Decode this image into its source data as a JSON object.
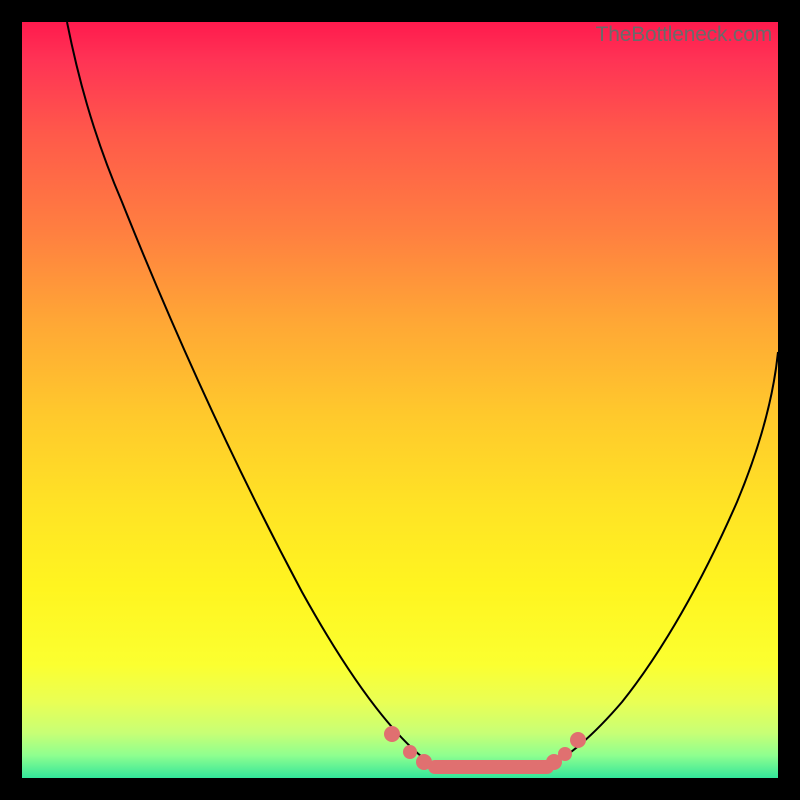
{
  "attribution": "TheBottleneck.com",
  "chart_data": {
    "type": "line",
    "title": "",
    "xlabel": "",
    "ylabel": "",
    "x_range": [
      0,
      100
    ],
    "y_range": [
      0,
      100
    ],
    "series": [
      {
        "name": "bottleneck-curve-left",
        "x": [
          6,
          10,
          15,
          20,
          25,
          30,
          35,
          40,
          45,
          48,
          50,
          52,
          54
        ],
        "y": [
          100,
          90,
          79,
          68,
          56,
          45,
          34,
          22,
          12,
          6,
          3,
          1.5,
          1
        ]
      },
      {
        "name": "bottleneck-curve-right",
        "x": [
          70,
          72,
          74,
          77,
          80,
          83,
          86,
          89,
          92,
          95,
          98,
          100
        ],
        "y": [
          1,
          1.5,
          2.5,
          4.5,
          7.5,
          12,
          18,
          25,
          33,
          42,
          52,
          60
        ]
      },
      {
        "name": "optimal-flat-region",
        "x": [
          54,
          56,
          58,
          60,
          62,
          64,
          66,
          68,
          70
        ],
        "y": [
          1,
          1,
          1,
          1,
          1,
          1,
          1,
          1,
          1
        ]
      }
    ],
    "markers": {
      "name": "optimal-points",
      "color": "#e07070",
      "points": [
        {
          "x": 48,
          "y": 5
        },
        {
          "x": 50,
          "y": 3
        },
        {
          "x": 52,
          "y": 1.8
        },
        {
          "x": 70,
          "y": 1.5
        },
        {
          "x": 71,
          "y": 2
        },
        {
          "x": 73,
          "y": 3.5
        }
      ]
    },
    "background_gradient": {
      "top": "#ff1a4d",
      "upper_mid": "#ffa835",
      "lower_mid": "#fff520",
      "bottom": "#33e69a"
    }
  }
}
